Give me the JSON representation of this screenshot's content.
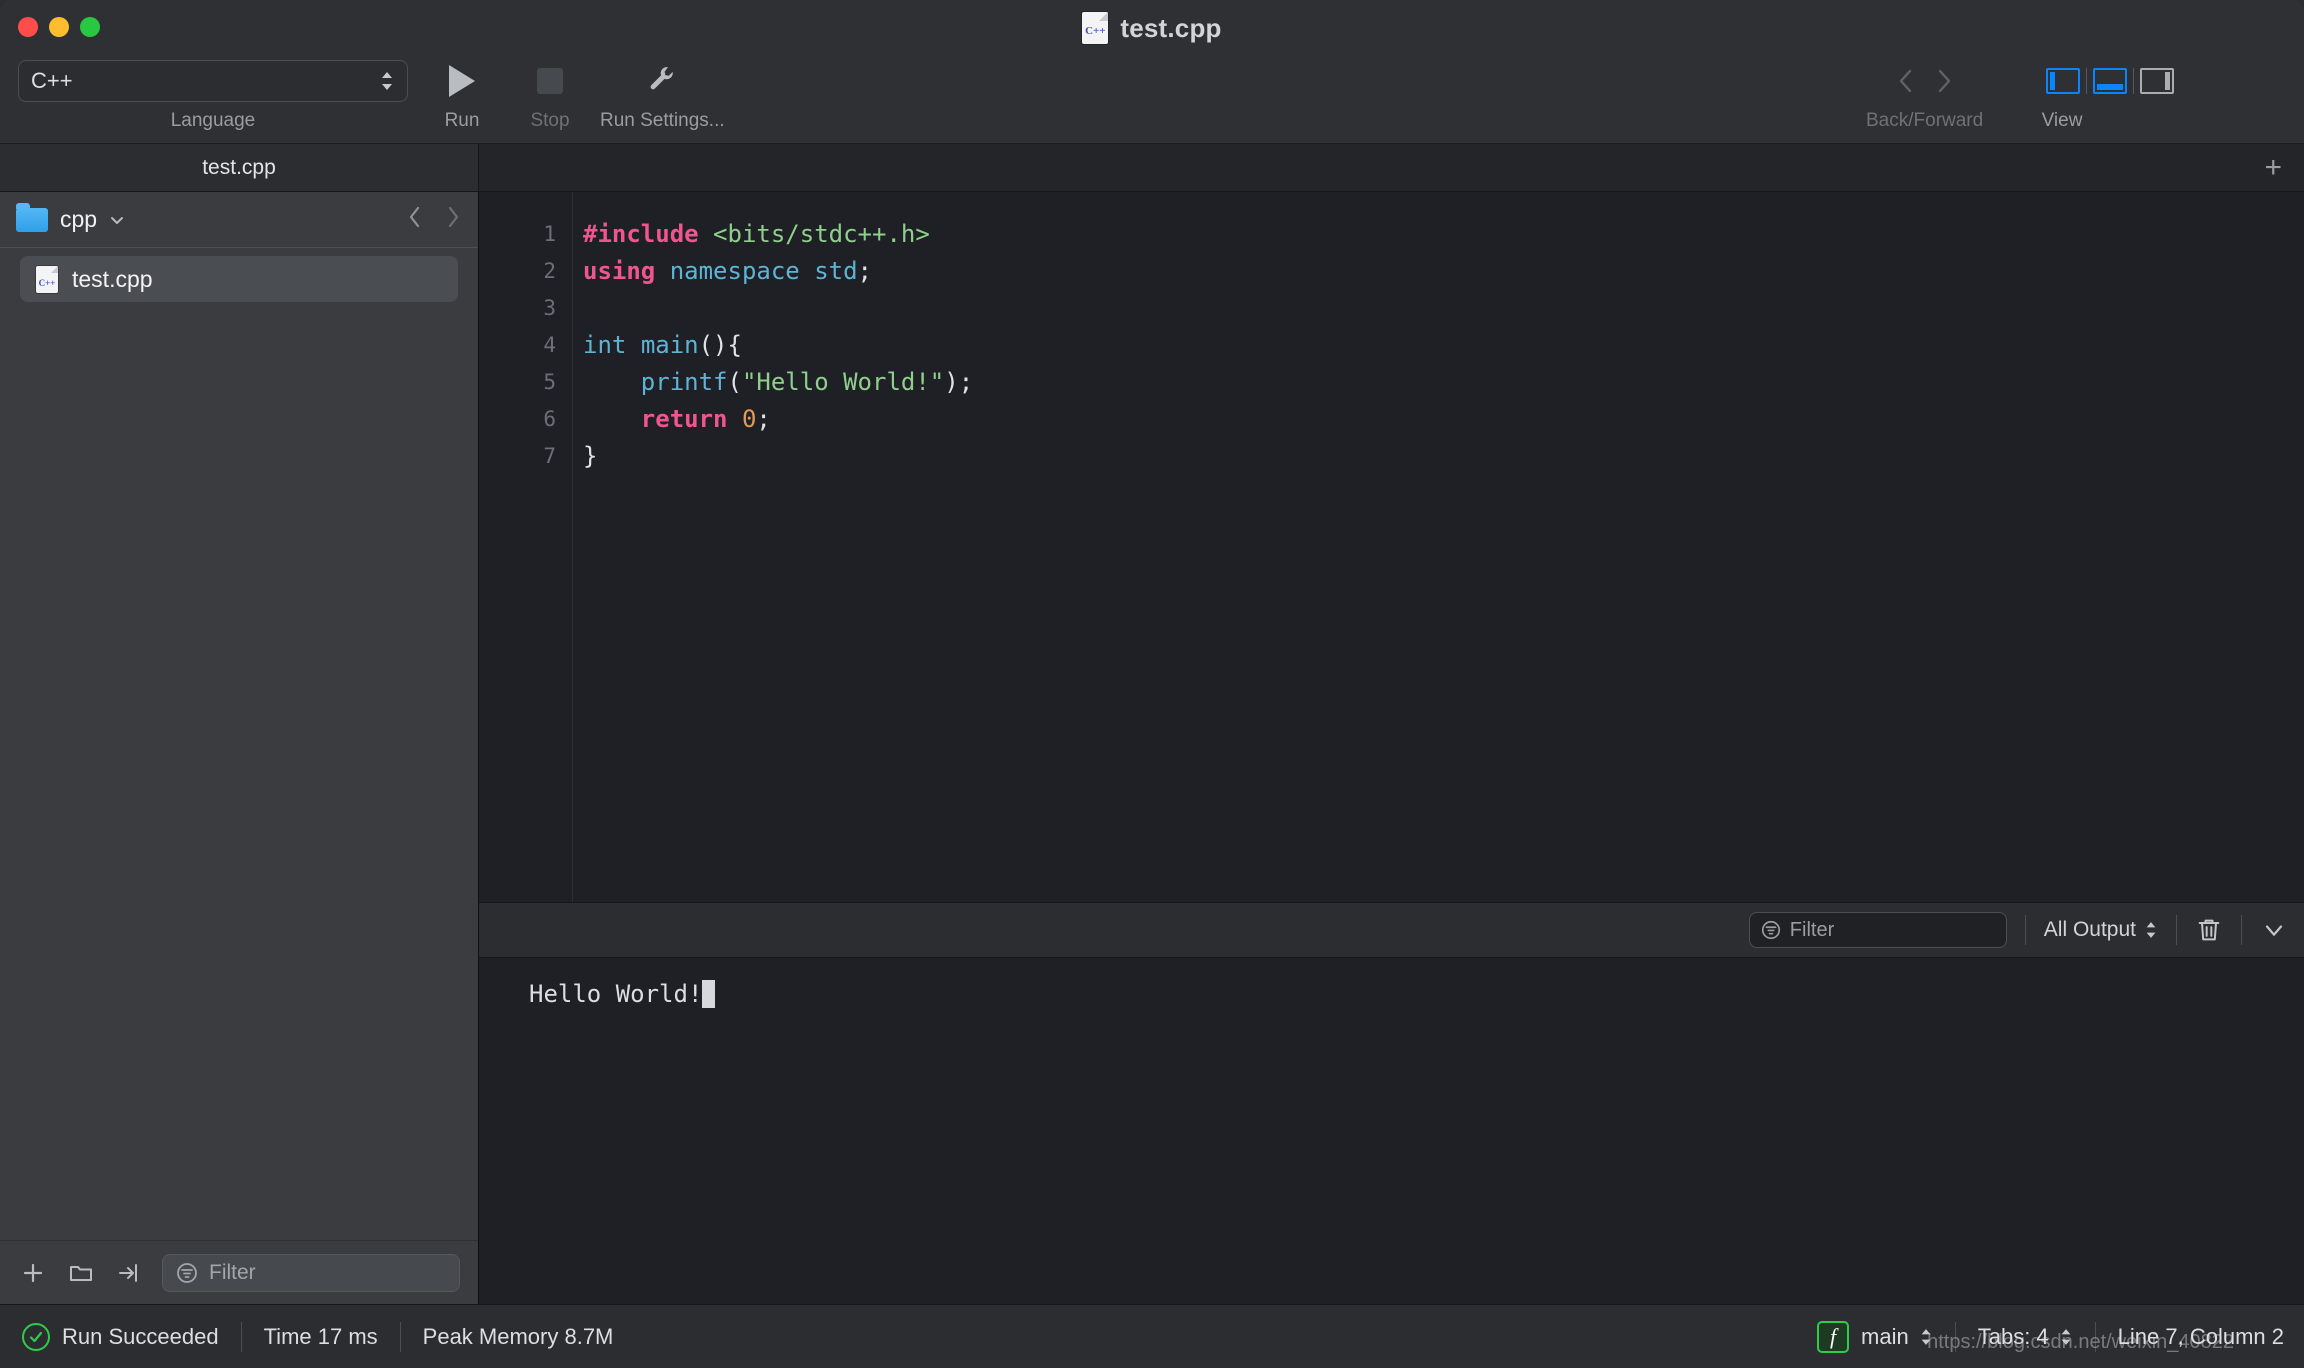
{
  "window": {
    "title": "test.cpp",
    "title_icon": "cpp-file-icon",
    "cpp_badge": "C++"
  },
  "toolbar": {
    "language": {
      "value": "C++",
      "label": "Language"
    },
    "run": {
      "label": "Run",
      "icon": "play-icon"
    },
    "stop": {
      "label": "Stop",
      "icon": "stop-icon"
    },
    "run_settings": {
      "label": "Run Settings...",
      "icon": "wrench-icon"
    },
    "back_forward": {
      "label": "Back/Forward",
      "back_icon": "chevron-left-icon",
      "forward_icon": "chevron-right-icon"
    },
    "view": {
      "label": "View",
      "left_panel": "panel-left-icon",
      "bottom_panel": "panel-bottom-icon",
      "right_panel": "panel-right-icon",
      "active_color": "#0a84ff",
      "inactive_color": "#a9acb0"
    }
  },
  "tabbar": {
    "tabs": [
      {
        "label": "test.cpp",
        "active": true
      }
    ],
    "add_label": "+"
  },
  "sidebar": {
    "folder": {
      "name": "cpp",
      "icon": "folder-icon",
      "chevron": "chevron-down-icon"
    },
    "nav": {
      "back": "chevron-left-icon",
      "forward": "chevron-right-icon"
    },
    "files": [
      {
        "name": "test.cpp",
        "icon": "cpp-file-icon",
        "selected": true
      }
    ],
    "footer": {
      "add": "plus-icon",
      "new_folder": "folder-icon",
      "import": "import-arrow-icon",
      "filter_placeholder": "Filter",
      "filter_value": "",
      "filter_icon": "filter-icon"
    }
  },
  "editor": {
    "line_numbers": [
      "1",
      "2",
      "3",
      "4",
      "5",
      "6",
      "7"
    ],
    "lines": [
      [
        {
          "t": "#include",
          "c": "k-pink"
        },
        {
          "t": " ",
          "c": "k-plain"
        },
        {
          "t": "<bits/stdc++.h>",
          "c": "k-green"
        }
      ],
      [
        {
          "t": "using",
          "c": "k-pink"
        },
        {
          "t": " ",
          "c": "k-plain"
        },
        {
          "t": "namespace std",
          "c": "k-blue"
        },
        {
          "t": ";",
          "c": "k-plain"
        }
      ],
      [
        {
          "t": "",
          "c": "k-plain"
        }
      ],
      [
        {
          "t": "int",
          "c": "k-blue"
        },
        {
          "t": " ",
          "c": "k-plain"
        },
        {
          "t": "main",
          "c": "k-blue"
        },
        {
          "t": "(){",
          "c": "k-plain"
        }
      ],
      [
        {
          "t": "    ",
          "c": "k-plain"
        },
        {
          "t": "printf",
          "c": "k-blue"
        },
        {
          "t": "(",
          "c": "k-plain"
        },
        {
          "t": "\"Hello World!\"",
          "c": "k-green"
        },
        {
          "t": ");",
          "c": "k-plain"
        }
      ],
      [
        {
          "t": "    ",
          "c": "k-plain"
        },
        {
          "t": "return",
          "c": "k-pink"
        },
        {
          "t": " ",
          "c": "k-plain"
        },
        {
          "t": "0",
          "c": "k-orange"
        },
        {
          "t": ";",
          "c": "k-plain"
        }
      ],
      [
        {
          "t": "}",
          "c": "k-plain"
        }
      ]
    ]
  },
  "console": {
    "filter_placeholder": "Filter",
    "filter_value": "",
    "filter_icon": "filter-icon",
    "output_scope": "All Output",
    "clear_icon": "trash-icon",
    "collapse_icon": "chevron-down-icon",
    "output_text": "Hello World!"
  },
  "status": {
    "result": "Run Succeeded",
    "result_icon": "check-circle-icon",
    "time": "Time 17 ms",
    "memory": "Peak Memory 8.7M",
    "function_badge": "f",
    "function": "main",
    "tabs": "Tabs: 4",
    "position": "Line 7, Column 2"
  },
  "watermark": "https://blog.csdn.net/weixin_40822"
}
